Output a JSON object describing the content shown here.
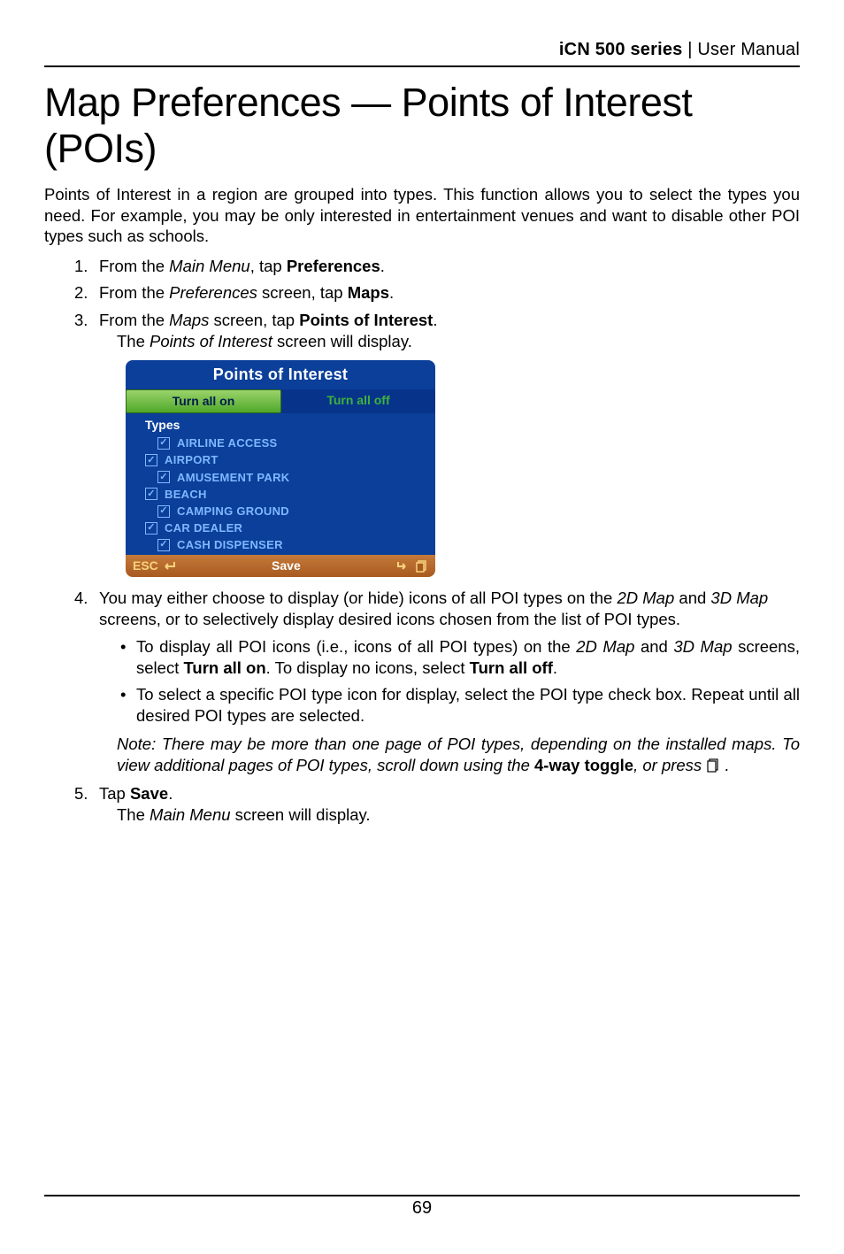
{
  "header": {
    "product": "iCN 500 series",
    "separator": " | ",
    "doc": "User Manual"
  },
  "title": "Map Preferences — Points of Interest (POIs)",
  "intro": "Points of Interest in a region are grouped into types. This function allows you to select the types you need. For example, you may be only interested in entertainment venues and want to disable other POI types such as schools.",
  "steps": {
    "s1_a": "From the ",
    "s1_i": "Main Menu",
    "s1_b": ", tap ",
    "s1_bold": "Preferences",
    "s1_c": ".",
    "s2_a": "From the ",
    "s2_i": "Preferences",
    "s2_b": " screen, tap ",
    "s2_bold": "Maps",
    "s2_c": ".",
    "s3_a": "From the ",
    "s3_i": "Maps",
    "s3_b": " screen, tap ",
    "s3_bold": "Points of Interest",
    "s3_c": ".",
    "s3_sub_a": "The ",
    "s3_sub_i": "Points of Interest",
    "s3_sub_b": " screen will display.",
    "s4_a": "You may either choose to display (or hide) icons of all POI types on the ",
    "s4_i1": "2D Map",
    "s4_b": " and ",
    "s4_i2": "3D Map",
    "s4_c": " screens, or to selectively display desired icons chosen from the list of POI types.",
    "bullet1_a": "To display all POI icons (i.e., icons of all POI types) on the ",
    "bullet1_i1": "2D Map",
    "bullet1_b": " and ",
    "bullet1_i2": "3D Map",
    "bullet1_c": " screens, select ",
    "bullet1_bold1": "Turn all on",
    "bullet1_d": ". To display no icons, select ",
    "bullet1_bold2": "Turn all off",
    "bullet1_e": ".",
    "bullet2": "To select a specific POI type icon for display, select the POI type check box. Repeat until all desired POI types are selected.",
    "note_a": "Note: There may be more than one page of POI types, depending on the installed maps. To view additional pages of POI types, scroll down using the ",
    "note_bold": "4-way toggle",
    "note_b": ", or press ",
    "note_c": " .",
    "s5_a": "Tap ",
    "s5_bold": "Save",
    "s5_b": ".",
    "s5_sub_a": "The ",
    "s5_sub_i": "Main Menu",
    "s5_sub_b": " screen will display."
  },
  "device": {
    "title": "Points of Interest",
    "tab_on": "Turn all on",
    "tab_off": "Turn all off",
    "types_label": "Types",
    "items": [
      "AIRLINE ACCESS",
      "AIRPORT",
      "AMUSEMENT PARK",
      "BEACH",
      "CAMPING GROUND",
      "CAR DEALER",
      "CASH DISPENSER"
    ],
    "esc": "ESC",
    "save": "Save"
  },
  "page_number": "69"
}
